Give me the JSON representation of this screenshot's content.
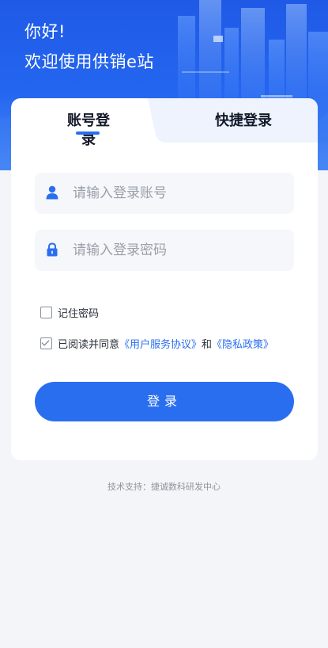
{
  "header": {
    "greeting": "你好!",
    "welcome": "欢迎使用供销e站"
  },
  "tabs": [
    {
      "label": "账号登录",
      "active": true
    },
    {
      "label": "快捷登录",
      "active": false
    }
  ],
  "form": {
    "account": {
      "placeholder": "请输入登录账号",
      "value": "",
      "icon": "user-icon"
    },
    "password": {
      "placeholder": "请输入登录密码",
      "value": "",
      "icon": "lock-icon"
    },
    "remember": {
      "label": "记住密码",
      "checked": false
    },
    "agreement": {
      "checked": true,
      "prefix": "已阅读并同意",
      "user_agreement": "《用户服务协议》",
      "and": "和",
      "privacy_policy": "《隐私政策》"
    },
    "login_label": "登录"
  },
  "footer": {
    "support": "技术支持：捷诚数科研发中心"
  },
  "colors": {
    "accent": "#2a6ef0",
    "hero_top": "#1f5ae6",
    "background": "#f4f5f9"
  }
}
